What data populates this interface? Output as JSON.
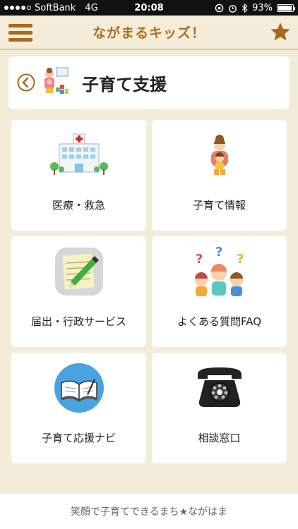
{
  "status": {
    "carrier": "SoftBank",
    "network": "4G",
    "time": "20:08",
    "battery_text": "93%",
    "battery_level": 0.93
  },
  "header": {
    "title": "ながまるキッズ！",
    "menu_icon": "hamburger-menu-icon",
    "favorite_icon": "star-icon",
    "accent_color": "#a9691c"
  },
  "page": {
    "title": "子育て支援",
    "back_icon": "back-chevron-icon",
    "category_icon": "family-illustration-icon"
  },
  "tiles": [
    {
      "label": "医療・救急",
      "icon": "hospital-icon"
    },
    {
      "label": "子育て情報",
      "icon": "parent-child-icon"
    },
    {
      "label": "届出・行政サービス",
      "icon": "notepad-pencil-icon"
    },
    {
      "label": "よくある質問FAQ",
      "icon": "family-questions-icon"
    },
    {
      "label": "子育て応援ナビ",
      "icon": "open-book-icon"
    },
    {
      "label": "相談窓口",
      "icon": "telephone-icon"
    }
  ],
  "footer": {
    "text": "笑顔で子育てできるまち★ながはま"
  },
  "colors": {
    "background": "#f3ecd9",
    "title_brown": "#b06d1c",
    "card": "#ffffff"
  }
}
